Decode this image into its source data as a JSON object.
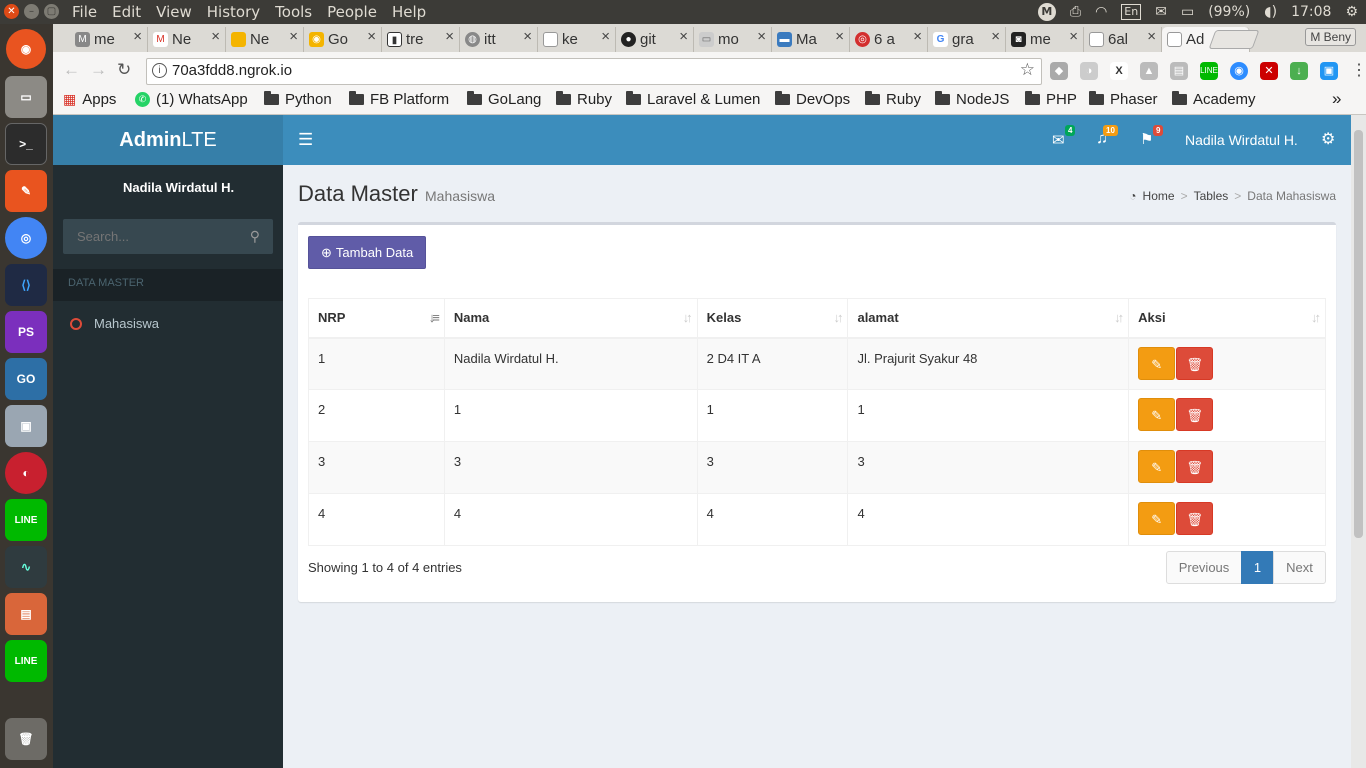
{
  "system": {
    "menu": [
      "File",
      "Edit",
      "View",
      "History",
      "Tools",
      "People",
      "Help"
    ],
    "indicator_m": "M",
    "lang": "En",
    "battery": "(99%)",
    "clock": "17:08"
  },
  "browser": {
    "tabs": [
      {
        "label": "me",
        "icon_color": "#888"
      },
      {
        "label": "Ne",
        "icon_color": "#d93025"
      },
      {
        "label": "Ne",
        "icon_color": "#f4b400"
      },
      {
        "label": "Go",
        "icon_color": "#f4b400"
      },
      {
        "label": "tre",
        "icon_color": "#333"
      },
      {
        "label": "itt",
        "icon_color": "#888"
      },
      {
        "label": "ke",
        "icon_color": "#999"
      },
      {
        "label": "git",
        "icon_color": "#222"
      },
      {
        "label": "mo",
        "icon_color": "#aaa"
      },
      {
        "label": "Ma",
        "icon_color": "#3b7bbf"
      },
      {
        "label": "6 a",
        "icon_color": "#d32f2f"
      },
      {
        "label": "gra",
        "icon_color": "#4285f4"
      },
      {
        "label": "me",
        "icon_color": "#222"
      },
      {
        "label": "6al",
        "icon_color": "#999"
      },
      {
        "label": "Ad",
        "icon_color": "#999"
      }
    ],
    "profile": "M Beny",
    "url": "70a3fdd8.ngrok.io",
    "bookmarks": {
      "apps": "Apps",
      "whatsapp": "(1) WhatsApp",
      "folders": [
        "Python",
        "FB Platform",
        "GoLang",
        "Ruby",
        "Laravel & Lumen",
        "DevOps",
        "Ruby",
        "NodeJS",
        "PHP",
        "Phaser",
        "Academy"
      ],
      "more": "»"
    }
  },
  "admin": {
    "logo_bold": "Admin",
    "logo_light": "LTE",
    "header": {
      "messages_count": "4",
      "notifications_count": "10",
      "tasks_count": "9",
      "user_name": "Nadila Wirdatul H."
    },
    "sidebar": {
      "user_name": "Nadila Wirdatul H.",
      "search_placeholder": "Search...",
      "section_header": "DATA MASTER",
      "menu_item": "Mahasiswa"
    },
    "page": {
      "title": "Data Master",
      "subtitle": "Mahasiswa",
      "breadcrumb": [
        "Home",
        "Tables",
        "Data Mahasiswa"
      ],
      "add_button": "Tambah Data"
    },
    "table": {
      "columns": [
        "NRP",
        "Nama",
        "Kelas",
        "alamat",
        "Aksi"
      ],
      "rows": [
        [
          "1",
          "Nadila Wirdatul H.",
          "2 D4 IT A",
          "Jl. Prajurit Syakur 48"
        ],
        [
          "2",
          "1",
          "1",
          "1"
        ],
        [
          "3",
          "3",
          "3",
          "3"
        ],
        [
          "4",
          "4",
          "4",
          "4"
        ]
      ]
    },
    "footer": {
      "info": "Showing 1 to 4 of 4 entries",
      "previous": "Previous",
      "page": "1",
      "next": "Next"
    }
  }
}
